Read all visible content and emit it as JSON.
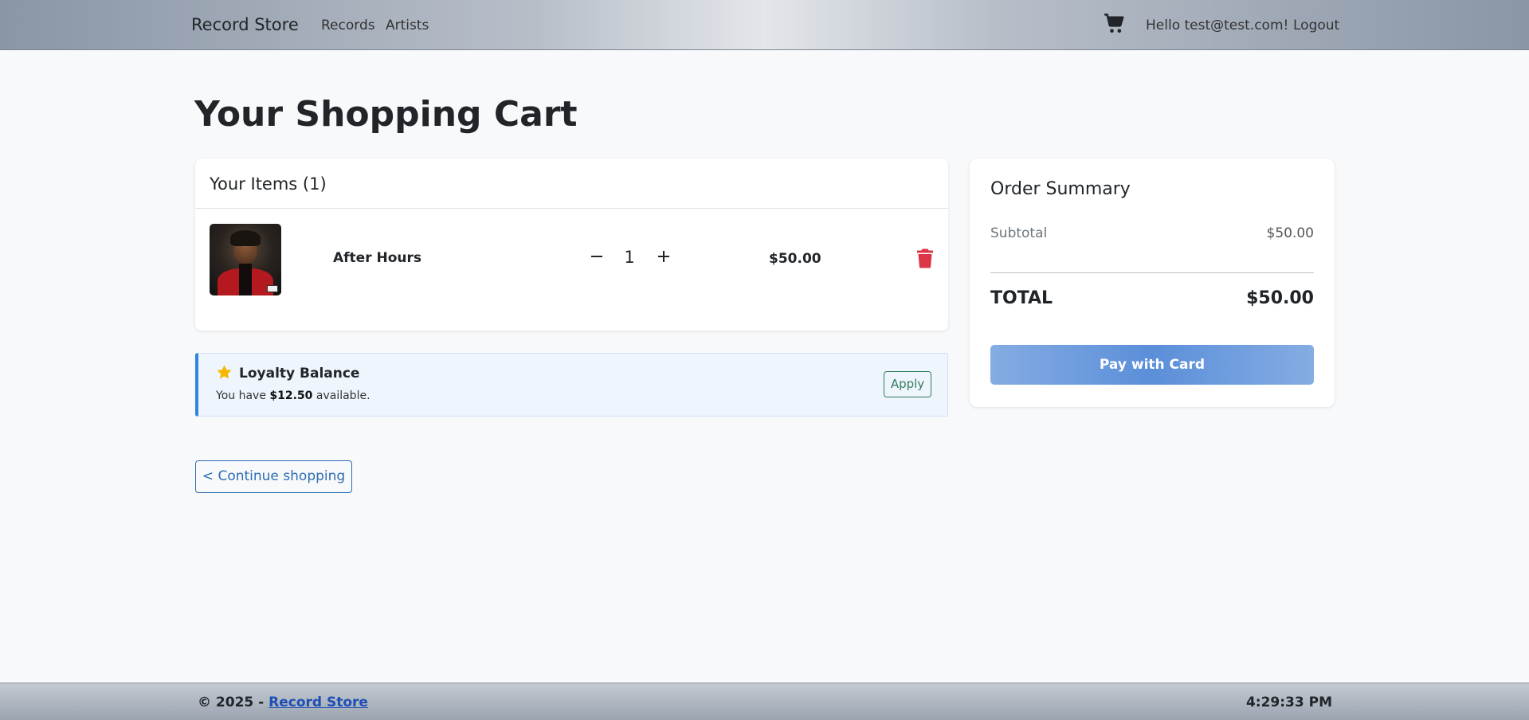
{
  "navbar": {
    "brand": "Record Store",
    "links": [
      "Records",
      "Artists"
    ],
    "cart_icon": "shopping-cart-icon",
    "greeting": "Hello test@test.com!",
    "logout": "Logout"
  },
  "page": {
    "title": "Your Shopping Cart"
  },
  "cart": {
    "header": "Your Items (1)",
    "items": [
      {
        "name": "After Hours",
        "quantity": "1",
        "price": "$50.00",
        "minus_icon": "minus-icon",
        "plus_icon": "plus-icon",
        "delete_icon": "trash-icon"
      }
    ]
  },
  "loyalty": {
    "icon": "star-icon",
    "title": "Loyalty Balance",
    "text_prefix": "You have",
    "amount": "$12.50",
    "text_suffix": "available.",
    "apply_label": "Apply"
  },
  "continue_label": "< Continue shopping",
  "summary": {
    "title": "Order Summary",
    "subtotal_label": "Subtotal",
    "subtotal_value": "$50.00",
    "total_label": "TOTAL",
    "total_value": "$50.00",
    "pay_label": "Pay with Card"
  },
  "footer": {
    "copyright": "© 2025 -",
    "link": "Record Store",
    "time": "4:29:33 PM"
  },
  "colors": {
    "danger": "#dc3545",
    "star": "#f5b800",
    "accent": "#2e86de",
    "pay_button": "#5b8fd9"
  }
}
